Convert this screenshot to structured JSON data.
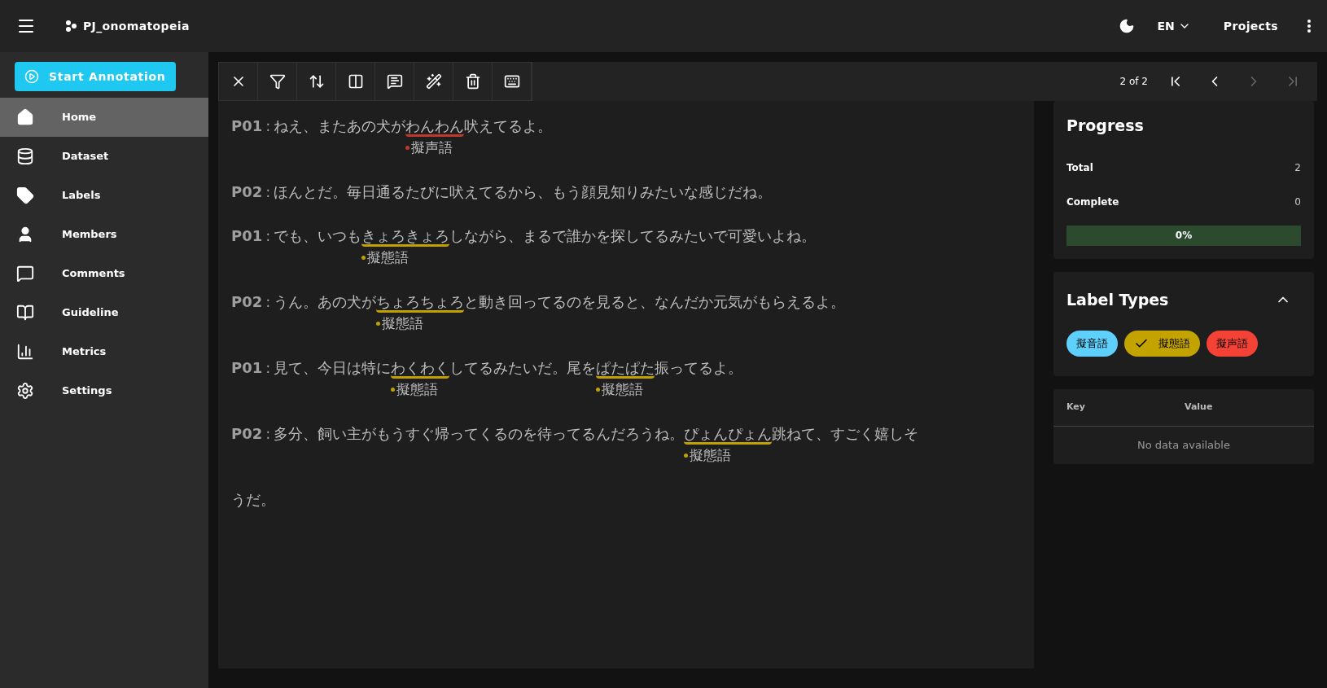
{
  "app_bar": {
    "project": "PJ_onomatopeia",
    "language": "EN",
    "projects_link": "Projects"
  },
  "sidebar": {
    "start_button": "Start Annotation",
    "items": [
      {
        "label": "Home",
        "selected": true
      },
      {
        "label": "Dataset",
        "selected": false
      },
      {
        "label": "Labels",
        "selected": false
      },
      {
        "label": "Members",
        "selected": false
      },
      {
        "label": "Comments",
        "selected": false
      },
      {
        "label": "Guideline",
        "selected": false
      },
      {
        "label": "Metrics",
        "selected": false
      },
      {
        "label": "Settings",
        "selected": false
      }
    ]
  },
  "toolbar": {
    "pagination": {
      "text": "2 of 2",
      "first_disabled": false,
      "prev_disabled": false,
      "next_disabled": true,
      "last_disabled": true
    }
  },
  "document": {
    "lines": [
      {
        "speaker": "P01",
        "separator": ":",
        "segments": [
          {
            "text": "ねえ、またあの犬が"
          },
          {
            "text": "わんわん",
            "label": "擬声語",
            "color": "#c0392b"
          },
          {
            "text": "吠えてるよ。"
          }
        ]
      },
      {
        "speaker": "P02",
        "separator": ":",
        "segments": [
          {
            "text": "ほんとだ。毎日通るたびに吠えてるから、もう顔見知りみたいな感じだね。"
          }
        ]
      },
      {
        "speaker": "P01",
        "separator": ":",
        "segments": [
          {
            "text": "でも、いつも"
          },
          {
            "text": "きょろきょろ",
            "label": "擬態語",
            "color": "#c2a000"
          },
          {
            "text": "しながら、まるで誰かを探してるみたいで可愛いよね。"
          }
        ]
      },
      {
        "speaker": "P02",
        "separator": ":",
        "segments": [
          {
            "text": "うん。あの犬が"
          },
          {
            "text": "ちょろちょろ",
            "label": "擬態語",
            "color": "#c2a000"
          },
          {
            "text": "と動き回ってるのを見ると、なんだか元気がもらえるよ。"
          }
        ]
      },
      {
        "speaker": "P01",
        "separator": ":",
        "segments": [
          {
            "text": "見て、今日は特に"
          },
          {
            "text": "わくわく",
            "label": "擬態語",
            "color": "#c2a000"
          },
          {
            "text": "してるみたいだ。尾を"
          },
          {
            "text": "ぱたぱた",
            "label": "擬態語",
            "color": "#c2a000"
          },
          {
            "text": "振ってるよ。"
          }
        ]
      },
      {
        "speaker": "P02",
        "separator": ":",
        "segments": [
          {
            "text": "多分、飼い主がもうすぐ帰ってくるのを待ってるんだろうね。"
          },
          {
            "text": "ぴょんぴょん",
            "label": "擬態語",
            "color": "#c2a000"
          },
          {
            "text": "跳ねて、すごく嬉しそ"
          }
        ]
      },
      {
        "segments": [
          {
            "text": "うだ。"
          }
        ]
      }
    ]
  },
  "progress": {
    "title": "Progress",
    "total_label": "Total",
    "total": "2",
    "complete_label": "Complete",
    "complete": "0",
    "bar_text": "0%",
    "level": 0
  },
  "label_types": {
    "title": "Label Types",
    "expanded": true,
    "chips": [
      {
        "text": "擬音語",
        "color": "#5fd0fb",
        "selected": false
      },
      {
        "text": "擬態語",
        "color": "#c2a300",
        "selected": true
      },
      {
        "text": "擬声語",
        "color": "#f44336",
        "selected": false
      }
    ]
  },
  "metadata": {
    "columns": [
      "Key",
      "Value"
    ],
    "empty_text": "No data available"
  }
}
